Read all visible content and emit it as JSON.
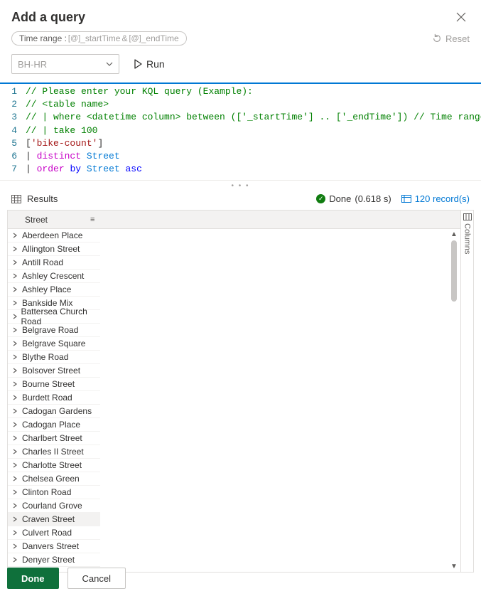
{
  "header": {
    "title": "Add a query"
  },
  "toolbar": {
    "time_range_label": "Time range :",
    "var_start": "_startTime",
    "amp": "&",
    "var_end": "_endTime",
    "reset_label": "Reset"
  },
  "controls": {
    "dropdown_value": "BH-HR",
    "run_label": "Run"
  },
  "editor": {
    "lines": [
      {
        "n": 1,
        "segments": [
          {
            "cls": "tk-comment",
            "t": "// Please enter your KQL query (Example):"
          }
        ]
      },
      {
        "n": 2,
        "segments": [
          {
            "cls": "tk-comment",
            "t": "// <table name>"
          }
        ]
      },
      {
        "n": 3,
        "segments": [
          {
            "cls": "tk-comment",
            "t": "// | where <datetime column> between (['_startTime'] .. ['_endTime']) // Time range filtering"
          }
        ]
      },
      {
        "n": 4,
        "segments": [
          {
            "cls": "tk-comment",
            "t": "// | take 100"
          }
        ]
      },
      {
        "n": 5,
        "segments": [
          {
            "cls": "tk-plain",
            "t": "["
          },
          {
            "cls": "tk-string",
            "t": "'bike-count'"
          },
          {
            "cls": "tk-plain",
            "t": "]"
          }
        ]
      },
      {
        "n": 6,
        "segments": [
          {
            "cls": "tk-plain",
            "t": "| "
          },
          {
            "cls": "tk-op",
            "t": "distinct"
          },
          {
            "cls": "tk-plain",
            "t": " "
          },
          {
            "cls": "tk-col",
            "t": "Street"
          }
        ]
      },
      {
        "n": 7,
        "segments": [
          {
            "cls": "tk-plain",
            "t": "| "
          },
          {
            "cls": "tk-op",
            "t": "order"
          },
          {
            "cls": "tk-plain",
            "t": " "
          },
          {
            "cls": "tk-kw",
            "t": "by"
          },
          {
            "cls": "tk-plain",
            "t": " "
          },
          {
            "cls": "tk-col",
            "t": "Street"
          },
          {
            "cls": "tk-plain",
            "t": " "
          },
          {
            "cls": "tk-kw",
            "t": "asc"
          }
        ]
      }
    ]
  },
  "results": {
    "title": "Results",
    "done_label": "Done",
    "done_time": "(0.618 s)",
    "record_count": "120 record(s)",
    "column_header": "Street",
    "columns_tab": "Columns",
    "rows": [
      "Aberdeen Place",
      "Allington Street",
      "Antill Road",
      "Ashley Crescent",
      "Ashley Place",
      "Bankside Mix",
      "Battersea Church Road",
      "Belgrave Road",
      "Belgrave Square",
      "Blythe Road",
      "Bolsover Street",
      "Bourne Street",
      "Burdett Road",
      "Cadogan Gardens",
      "Cadogan Place",
      "Charlbert Street",
      "Charles II Street",
      "Charlotte Street",
      "Chelsea Green",
      "Clinton Road",
      "Courland Grove",
      "Craven Street",
      "Culvert Road",
      "Danvers Street",
      "Denyer Street"
    ],
    "highlight_index": 21
  },
  "footer": {
    "done_label": "Done",
    "cancel_label": "Cancel"
  }
}
